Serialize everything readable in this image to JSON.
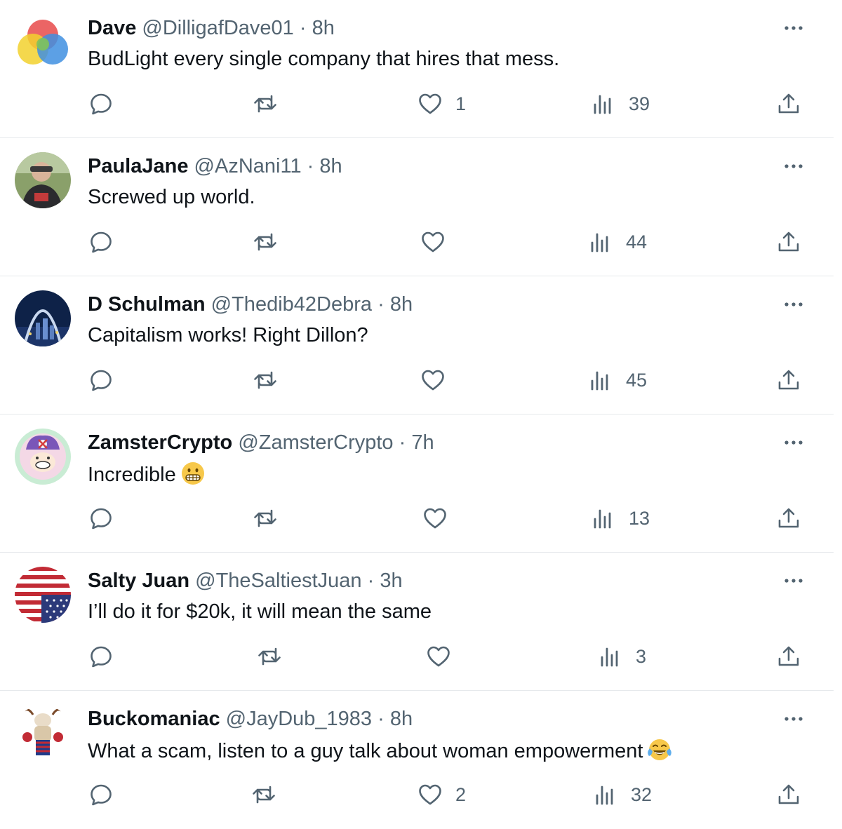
{
  "tweets": [
    {
      "name": "Dave",
      "handle": "@DilligafDave01",
      "separator": "·",
      "time": "8h",
      "text": "BudLight every single company that hires that mess.",
      "emoji": "",
      "likes": "1",
      "views": "39"
    },
    {
      "name": "PaulaJane",
      "handle": "@AzNani11",
      "separator": "·",
      "time": "8h",
      "text": "Screwed up world.",
      "emoji": "",
      "likes": "",
      "views": "44"
    },
    {
      "name": "D Schulman",
      "handle": "@Thedib42Debra",
      "separator": "·",
      "time": "8h",
      "text": "Capitalism works! Right Dillon?",
      "emoji": "",
      "likes": "",
      "views": "45"
    },
    {
      "name": "ZamsterCrypto",
      "handle": "@ZamsterCrypto",
      "separator": "·",
      "time": "7h",
      "text": "Incredible",
      "emoji": "grimacing-face",
      "likes": "",
      "views": "13"
    },
    {
      "name": "Salty Juan",
      "handle": "@TheSaltiestJuan",
      "separator": "·",
      "time": "3h",
      "text": "I’ll do it for $20k, it will mean the same",
      "emoji": "",
      "likes": "",
      "views": "3"
    },
    {
      "name": "Buckomaniac",
      "handle": "@JayDub_1983",
      "separator": "·",
      "time": "8h",
      "text": "What a scam, listen to a guy talk about woman empowerment",
      "emoji": "face-with-tears-of-joy",
      "likes": "2",
      "views": "32"
    }
  ],
  "colors": {
    "text": "#0f1419",
    "secondary": "#536471",
    "divider": "#e6e9ec"
  },
  "icons": {
    "reply": "reply-icon",
    "retweet": "retweet-icon",
    "like": "heart-icon",
    "views": "views-icon",
    "share": "share-icon",
    "more": "more-icon"
  }
}
